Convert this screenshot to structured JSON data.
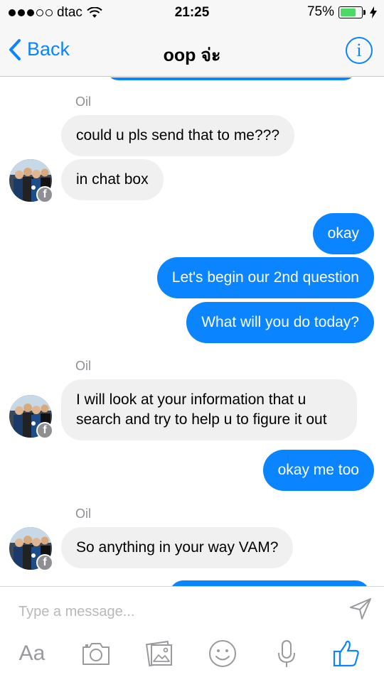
{
  "status_bar": {
    "carrier": "dtac",
    "time": "21:25",
    "battery_percent_text": "75%",
    "battery_level": 0.75,
    "signal_icon": "signal-dots-icon",
    "wifi_icon": "wifi-icon",
    "charging_icon": "charging-bolt-icon"
  },
  "nav": {
    "back_label": "Back",
    "title": "oop จ่ะ",
    "info_label": "i"
  },
  "messages": [
    {
      "sender": "Oil",
      "direction": "in",
      "text": "could u pls send that to me???"
    },
    {
      "direction": "in",
      "text": "in chat box"
    },
    {
      "direction": "out",
      "text": "okay"
    },
    {
      "direction": "out",
      "text": "Let's begin our 2nd question"
    },
    {
      "direction": "out",
      "text": "What will you do today?"
    },
    {
      "sender": "Oil",
      "direction": "in",
      "text": "I will look at your information that u search and try to help u to figure it out"
    },
    {
      "direction": "out",
      "text": "okay me too"
    },
    {
      "sender": "Oil",
      "direction": "in",
      "text": "So anything in your way VAM?"
    }
  ],
  "avatar_badge": "f",
  "composer": {
    "placeholder": "Type a message...",
    "text_tool_label": "Aa"
  },
  "colors": {
    "accent": "#0a84ff",
    "incoming_bubble": "#f0f0f0",
    "battery": "#4cd964",
    "muted": "#8e8e93"
  }
}
